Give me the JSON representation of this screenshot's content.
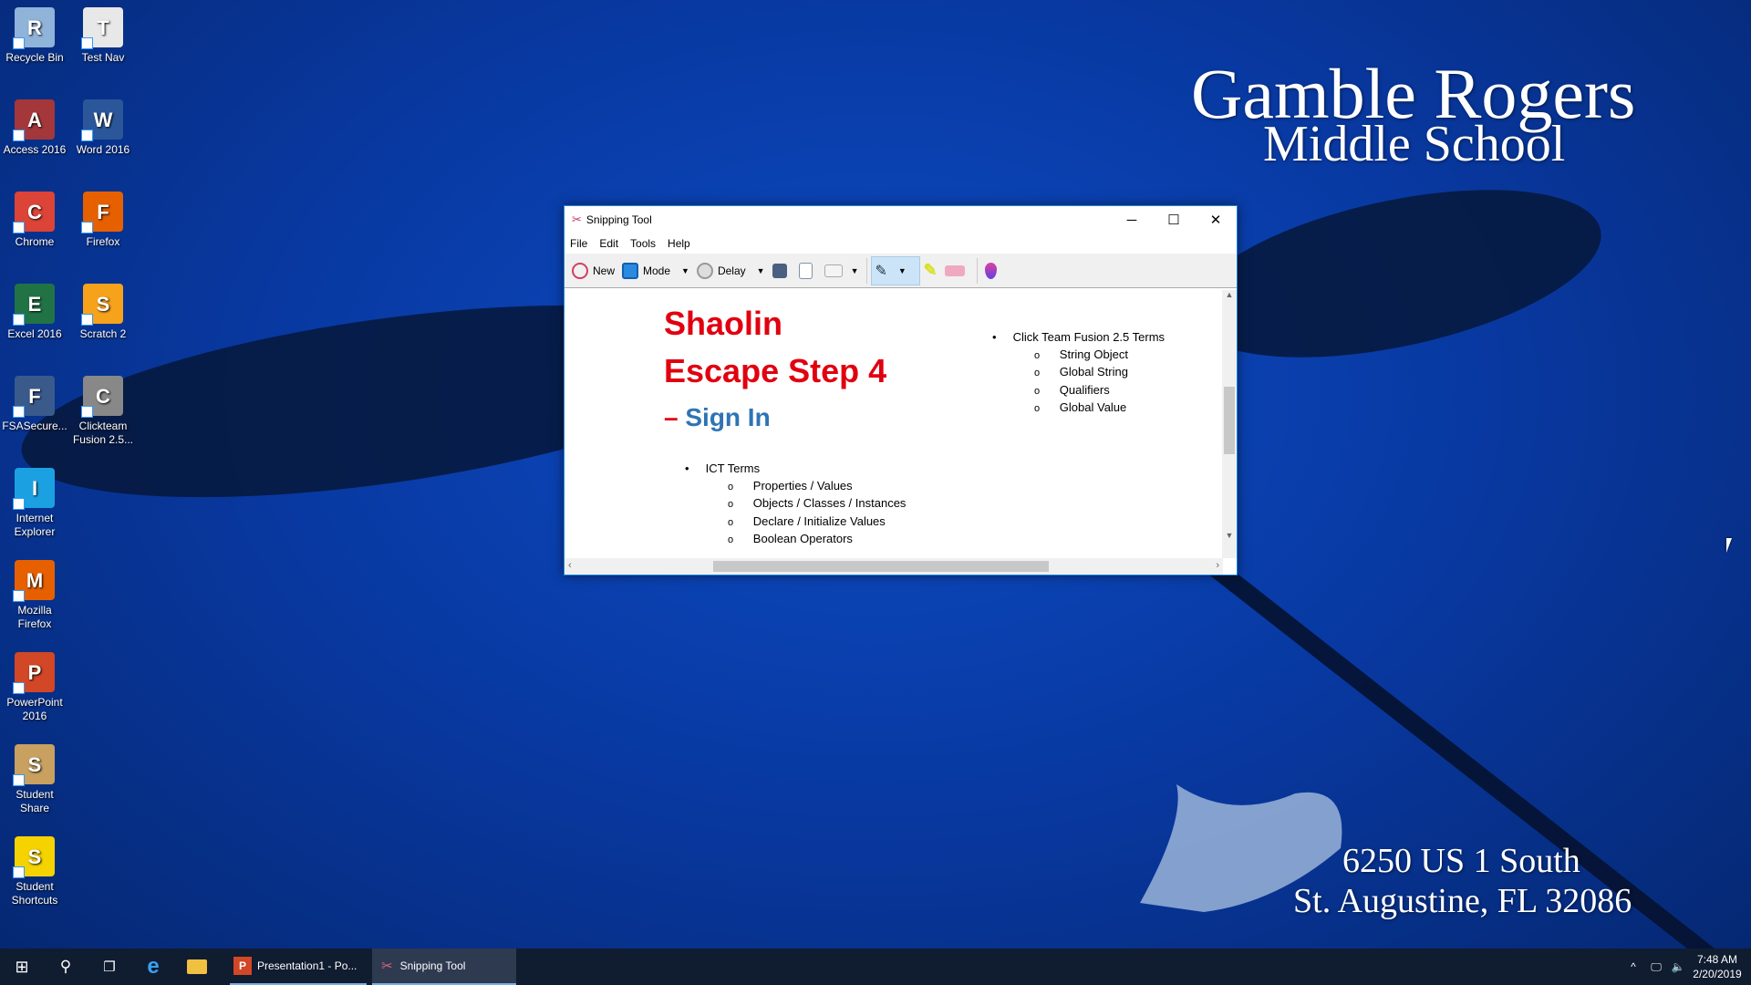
{
  "wallpaper": {
    "school_line1": "Gamble Rogers",
    "school_line2": "Middle School",
    "address_line1": "6250 US 1 South",
    "address_line2": "St. Augustine, FL 32086"
  },
  "desktop_icons": [
    {
      "label": "Recycle Bin",
      "icon": "recycle-bin-icon",
      "color": "#8fb3d9"
    },
    {
      "label": "Test Nav",
      "icon": "testnav-icon",
      "color": "#e8e8e8"
    },
    {
      "label": "Access 2016",
      "icon": "access-icon",
      "color": "#a4373a"
    },
    {
      "label": "Word 2016",
      "icon": "word-icon",
      "color": "#2b579a"
    },
    {
      "label": "Chrome",
      "icon": "chrome-icon",
      "color": "#db4437"
    },
    {
      "label": "Firefox",
      "icon": "firefox-icon",
      "color": "#e66000"
    },
    {
      "label": "Excel 2016",
      "icon": "excel-icon",
      "color": "#217346"
    },
    {
      "label": "Scratch 2",
      "icon": "scratch-icon",
      "color": "#f7a21b"
    },
    {
      "label": "FSASecure...",
      "icon": "fsasecure-icon",
      "color": "#3a5a8c"
    },
    {
      "label": "Clickteam Fusion 2.5...",
      "icon": "clickteam-icon",
      "color": "#888888"
    },
    {
      "label": "Internet Explorer",
      "icon": "internet-explorer-icon",
      "color": "#1ba1e2"
    },
    {
      "label": "Mozilla Firefox",
      "icon": "firefox-icon",
      "color": "#e66000"
    },
    {
      "label": "PowerPoint 2016",
      "icon": "powerpoint-icon",
      "color": "#d24726"
    },
    {
      "label": "Student Share",
      "icon": "student-share-icon",
      "color": "#c8a060"
    },
    {
      "label": "Student Shortcuts",
      "icon": "star-icon",
      "color": "#f5d300"
    }
  ],
  "snipping_tool": {
    "title": "Snipping Tool",
    "menu": [
      "File",
      "Edit",
      "Tools",
      "Help"
    ],
    "toolbar": {
      "new": "New",
      "mode": "Mode",
      "delay": "Delay"
    },
    "doc": {
      "title1": "Shaolin",
      "title2": "Escape Step 4",
      "dash": "–",
      "subtitle": "Sign In",
      "left_list": {
        "head": "ICT Terms",
        "items": [
          "Properties / Values",
          "Objects / Classes / Instances",
          "Declare / Initialize Values",
          "Boolean Operators"
        ]
      },
      "right_list": {
        "head": "Click Team Fusion 2.5 Terms",
        "items": [
          "String Object",
          "Global String",
          "Qualifiers",
          "Global Value"
        ]
      }
    }
  },
  "taskbar": {
    "apps": [
      {
        "label": "Presentation1 - Po..."
      },
      {
        "label": "Snipping Tool",
        "active": true
      }
    ],
    "time": "7:48 AM",
    "date": "2/20/2019"
  }
}
